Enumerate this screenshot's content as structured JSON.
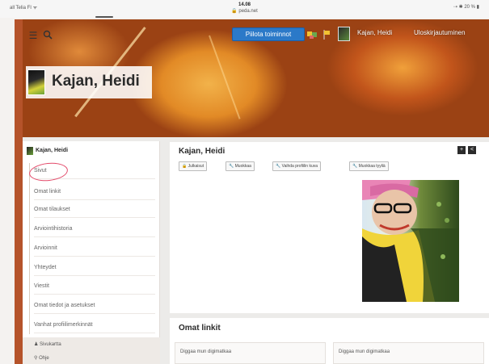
{
  "status_bar": {
    "left": "all Telia FI ᯤ",
    "time": "14.08",
    "url": "🔒 peda.net",
    "right": "⇢ ✱ 20 % ▮"
  },
  "toolbar": {
    "menu_icon": "menu-icon",
    "search_icon": "search-icon",
    "hide_functions": "Piilota toiminnot",
    "user_name": "Kajan, Heidi",
    "logout": "Uloskirjautuminen"
  },
  "profile": {
    "name": "Kajan, Heidi"
  },
  "sidebar": {
    "user": "Kajan, Heidi",
    "items": [
      {
        "label": "Sivut"
      },
      {
        "label": "Omat linkit"
      },
      {
        "label": "Omat tilaukset"
      },
      {
        "label": "Arviointihistoria"
      },
      {
        "label": "Arvioinnit"
      },
      {
        "label": "Yhteydet"
      },
      {
        "label": "Viestit"
      },
      {
        "label": "Omat tiedot ja asetukset"
      },
      {
        "label": "Vanhat profiilimerkinnät"
      }
    ],
    "footer": {
      "item1": "Sivukartta",
      "item2": "Ohje"
    }
  },
  "main": {
    "title": "Kajan, Heidi",
    "actions": [
      {
        "label": "Julkaisut",
        "icon": "lock-icon"
      },
      {
        "label": "Muokkaa",
        "icon": "wrench-icon"
      },
      {
        "label": "Vaihda profiilin kuva",
        "icon": "wrench-icon"
      },
      {
        "label": "Muokkaa tyyliä",
        "icon": "wrench-icon"
      }
    ]
  },
  "links": {
    "title": "Omat linkit",
    "items": [
      {
        "label": "Diggaa mun digimatkaa"
      },
      {
        "label": "Diggaa mun digimatkaa"
      }
    ]
  },
  "colors": {
    "accent_blue": "#2b79c8",
    "banner_orange": "#b5532a",
    "annotation_pink": "#e34a6a"
  }
}
